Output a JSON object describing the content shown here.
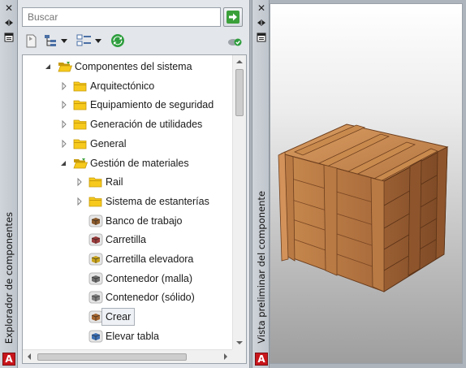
{
  "left_panel": {
    "title": "Explorador de componentes",
    "search": {
      "placeholder": "Buscar",
      "value": ""
    },
    "tree": [
      {
        "label": "Componentes del sistema",
        "level": 0,
        "expander": "expanded",
        "icon": "folder-open-icon"
      },
      {
        "label": "Arquitectónico",
        "level": 1,
        "expander": "collapsed",
        "icon": "folder-icon"
      },
      {
        "label": "Equipamiento de seguridad",
        "level": 1,
        "expander": "collapsed",
        "icon": "folder-icon"
      },
      {
        "label": "Generación de utilidades",
        "level": 1,
        "expander": "collapsed",
        "icon": "folder-icon"
      },
      {
        "label": "General",
        "level": 1,
        "expander": "collapsed",
        "icon": "folder-icon"
      },
      {
        "label": "Gestión de materiales",
        "level": 1,
        "expander": "expanded",
        "icon": "folder-open-icon"
      },
      {
        "label": "Rail",
        "level": 2,
        "expander": "collapsed",
        "icon": "folder-icon"
      },
      {
        "label": "Sistema de estanterías",
        "level": 2,
        "expander": "collapsed",
        "icon": "folder-icon"
      },
      {
        "label": "Banco de trabajo",
        "level": 2,
        "expander": "none",
        "icon": "workbench-icon"
      },
      {
        "label": "Carretilla",
        "level": 2,
        "expander": "none",
        "icon": "handcart-icon"
      },
      {
        "label": "Carretilla elevadora",
        "level": 2,
        "expander": "none",
        "icon": "forklift-icon"
      },
      {
        "label": "Contenedor (malla)",
        "level": 2,
        "expander": "none",
        "icon": "mesh-container-icon"
      },
      {
        "label": "Contenedor (sólido)",
        "level": 2,
        "expander": "none",
        "icon": "solid-container-icon"
      },
      {
        "label": "Crear",
        "level": 2,
        "expander": "none",
        "icon": "crate-icon",
        "selected": true
      },
      {
        "label": "Elevar tabla",
        "level": 2,
        "expander": "none",
        "icon": "lift-table-icon"
      }
    ]
  },
  "right_panel": {
    "title": "Vista preliminar del componente",
    "preview_subject": "wooden-crate"
  },
  "colors": {
    "folder": "#f6c91c",
    "folder_dark": "#c79a0b",
    "go_arrow": "#3aa03a",
    "refresh": "#2e9e3e",
    "brand_red": "#c8151b",
    "wood_light": "#c98a4e",
    "wood_mid": "#a7693a",
    "wood_dark": "#6e3f1e"
  }
}
